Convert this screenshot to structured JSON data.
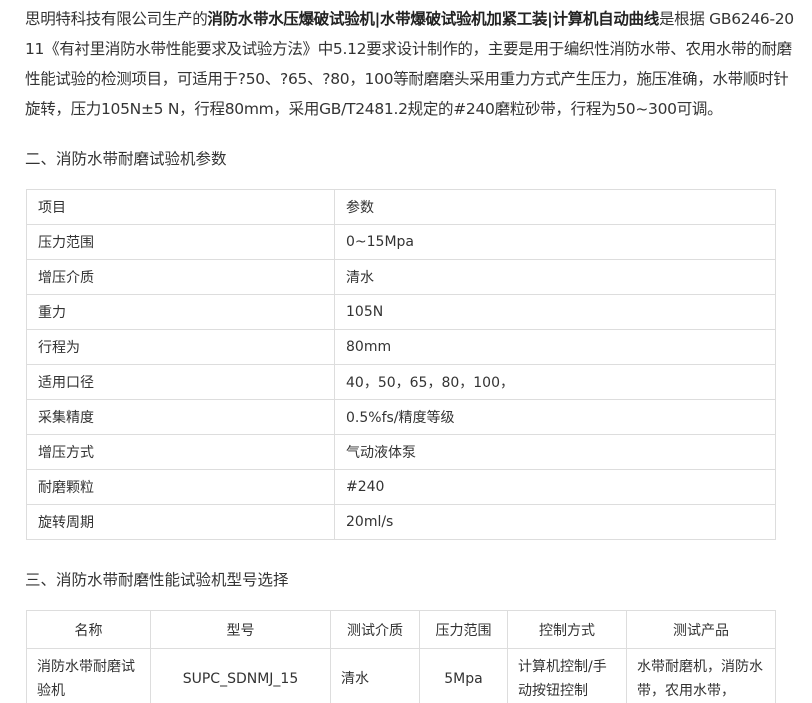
{
  "intro": {
    "p1": "思明特科技有限公司生产的",
    "bold1": "消防水带水压爆破试验机|水带爆破试验机加紧工装|计算机自动曲线",
    "p2": "是根据 GB6246-2011《有衬里消防水带性能要求及试验方法》中5.12要求设计制作的，主要是用于编织性消防水带、农用水带的耐磨性能试验的检测项目，可适用于?50、?65、?80，100等耐磨磨头采用重力方式产生压力，施压准确，水带顺时针旋转，压力105N±5 N，行程80mm，采用GB/T2481.2规定的#240磨粒砂带，行程为50~300可调。"
  },
  "section1_title": "二、消防水带耐磨试验机参数",
  "params": {
    "header": [
      "项目",
      "参数"
    ],
    "rows": [
      [
        "压力范围",
        "0~15Mpa"
      ],
      [
        "增压介质",
        "清水"
      ],
      [
        "重力",
        "105N"
      ],
      [
        "行程为",
        "80mm"
      ],
      [
        "适用口径",
        "40，50，65，80，100，"
      ],
      [
        "采集精度",
        "0.5%fs/精度等级"
      ],
      [
        "增压方式",
        "气动液体泵"
      ],
      [
        "耐磨颗粒",
        "#240"
      ],
      [
        "旋转周期",
        "20ml/s"
      ]
    ]
  },
  "section2_title": "三、消防水带耐磨性能试验机型号选择",
  "models": {
    "header": [
      "名称",
      "型号",
      "测试介质",
      "压力范围",
      "控制方式",
      "测试产品"
    ],
    "rows": [
      [
        "消防水带耐磨试验机",
        "SUPC_SDNMJ_15",
        "清水",
        "5Mpa",
        "计算机控制/手动按钮控制",
        "水带耐磨机，消防水带，农用水带，"
      ]
    ]
  }
}
